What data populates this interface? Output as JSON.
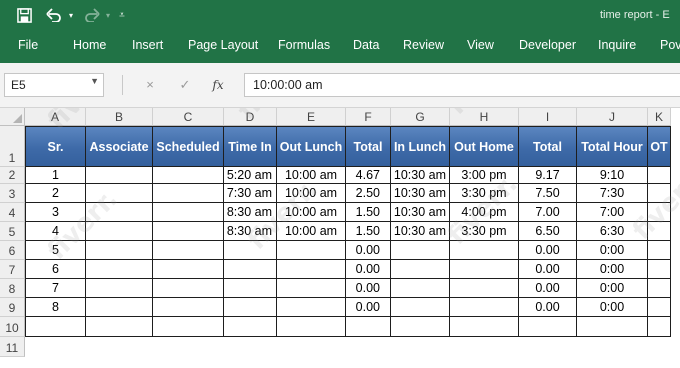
{
  "window": {
    "title": "time report - E"
  },
  "ribbon": {
    "tabs": [
      "File",
      "Home",
      "Insert",
      "Page Layout",
      "Formulas",
      "Data",
      "Review",
      "View",
      "Developer",
      "Inquire",
      "Pov"
    ]
  },
  "formula_bar": {
    "name_box": "E5",
    "cancel_icon": "×",
    "enter_icon": "✓",
    "fx_label": "fx",
    "value": "10:00:00 am"
  },
  "sheet": {
    "columns": [
      "A",
      "B",
      "C",
      "D",
      "E",
      "F",
      "G",
      "H",
      "I",
      "J",
      "K"
    ],
    "rows": [
      "1",
      "2",
      "3",
      "4",
      "5",
      "6",
      "7",
      "8",
      "9",
      "10",
      "11"
    ],
    "headers": [
      "Sr.",
      "Associate",
      "Scheduled",
      "Time In",
      "Out Lunch",
      "Total",
      "In Lunch",
      "Out Home",
      "Total",
      "Total Hour",
      "OT"
    ],
    "data": [
      [
        "1",
        "",
        "",
        "5:20 am",
        "10:00 am",
        "4.67",
        "10:30 am",
        "3:00 pm",
        "9.17",
        "9:10",
        ""
      ],
      [
        "2",
        "",
        "",
        "7:30 am",
        "10:00 am",
        "2.50",
        "10:30 am",
        "3:30 pm",
        "7.50",
        "7:30",
        ""
      ],
      [
        "3",
        "",
        "",
        "8:30 am",
        "10:00 am",
        "1.50",
        "10:30 am",
        "4:00 pm",
        "7.00",
        "7:00",
        ""
      ],
      [
        "4",
        "",
        "",
        "8:30 am",
        "10:00 am",
        "1.50",
        "10:30 am",
        "3:30 pm",
        "6.50",
        "6:30",
        ""
      ],
      [
        "5",
        "",
        "",
        "",
        "",
        "0.00",
        "",
        "",
        "0.00",
        "0:00",
        ""
      ],
      [
        "6",
        "",
        "",
        "",
        "",
        "0.00",
        "",
        "",
        "0.00",
        "0:00",
        ""
      ],
      [
        "7",
        "",
        "",
        "",
        "",
        "0.00",
        "",
        "",
        "0.00",
        "0:00",
        ""
      ],
      [
        "8",
        "",
        "",
        "",
        "",
        "0.00",
        "",
        "",
        "0.00",
        "0:00",
        ""
      ],
      [
        "",
        "",
        "",
        "",
        "",
        "",
        "",
        "",
        "",
        "",
        ""
      ]
    ]
  },
  "watermark": "fiverr.",
  "colors": {
    "ribbon": "#217346",
    "header_fill": "#3e6aa8",
    "grid_line": "#1e1e1e"
  }
}
